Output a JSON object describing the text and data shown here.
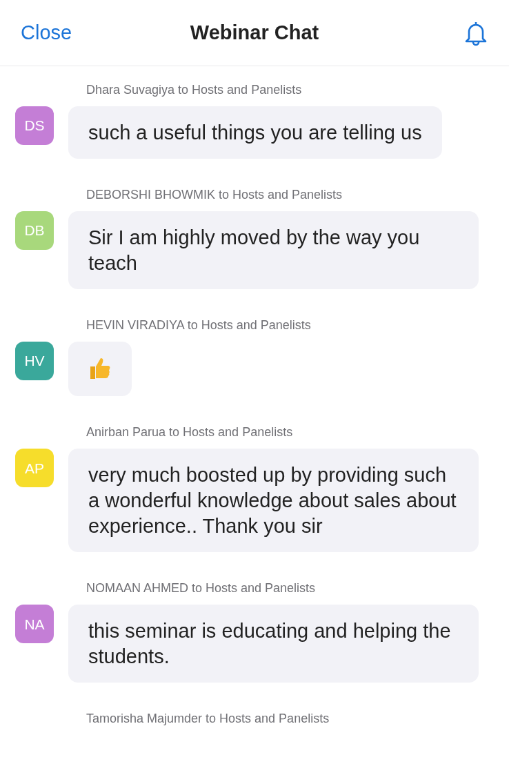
{
  "header": {
    "close": "Close",
    "title": "Webinar Chat"
  },
  "messages": [
    {
      "sender": "Dhara Suvagiya to Hosts and Panelists",
      "initials": "DS",
      "color": "#c47ed6",
      "kind": "text",
      "text": "such a useful things you are telling us"
    },
    {
      "sender": "DEBORSHI BHOWMIK to Hosts and Panelists",
      "initials": "DB",
      "color": "#a8d87c",
      "kind": "text",
      "text": "Sir I am highly moved by the way you teach"
    },
    {
      "sender": "HEVIN VIRADIYA to Hosts and Panelists",
      "initials": "HV",
      "color": "#3aa89b",
      "kind": "thumbs_up"
    },
    {
      "sender": "Anirban Parua to Hosts and Panelists",
      "initials": "AP",
      "color": "#f6dd2b",
      "kind": "text",
      "text": "very much boosted up by providing such a wonderful knowledge about sales about experience.. Thank you sir"
    },
    {
      "sender": "NOMAAN AHMED to Hosts and Panelists",
      "initials": "NA",
      "color": "#c47ed6",
      "kind": "text",
      "text": "this seminar is educating and helping the students."
    }
  ],
  "trailing_sender": "Tamorisha Majumder to Hosts and Panelists"
}
